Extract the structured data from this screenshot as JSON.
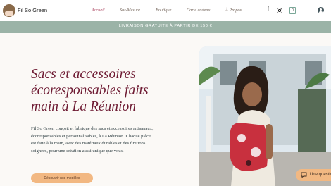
{
  "header": {
    "brand": "Fil So Green",
    "nav": [
      "Accueil",
      "Sur-Mesure",
      "Boutique",
      "Carte cadeau",
      "À Propos"
    ],
    "cart_count": "0",
    "icons": [
      "facebook-icon",
      "instagram-icon",
      "cart-icon",
      "user-icon"
    ]
  },
  "banner": {
    "text": "LIVRAISON GRATUITE À PARTIR DE 150 €"
  },
  "hero": {
    "headline": [
      "Sacs et accessoires",
      "écoresponsables faits",
      "main à La Réunion"
    ],
    "description": [
      "Fil So Green conçoit et fabrique des sacs et accessoires artisanaux,",
      "écoresponsables et personnalisables, à La Réunion. Chaque pièce",
      "est faite à la main, avec des matériaux durables et des finitions",
      "soignées, pour une création aussi unique que vous."
    ],
    "cta": "Découvrir nos modèles"
  },
  "chat": {
    "label": "Une question ?"
  },
  "colors": {
    "accent": "#a83d5a",
    "headline": "#6e1b33",
    "banner": "#9bb3a7",
    "cta": "#f2b882"
  }
}
